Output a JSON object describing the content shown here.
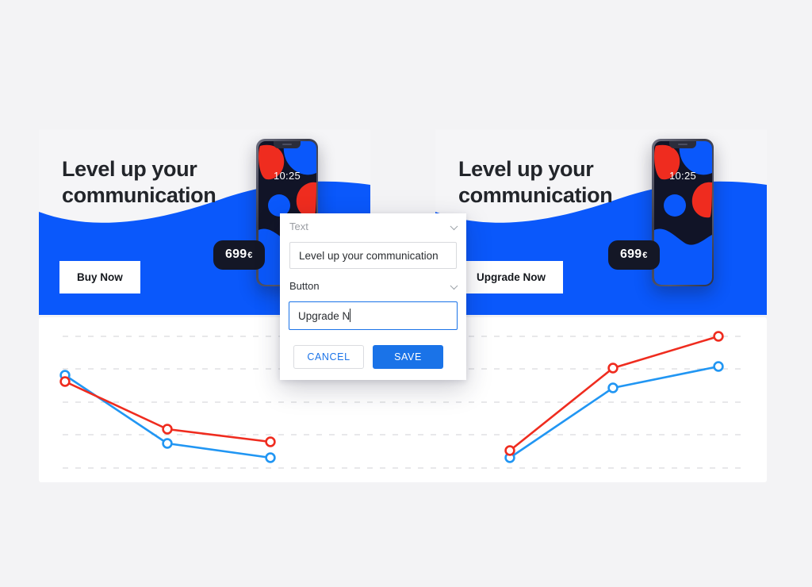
{
  "theme": {
    "page_bg": "#f3f3f5",
    "card_bg": "#f5f5f7",
    "brand_blue": "#0a58fb",
    "accent_blue": "#1a73e8",
    "line_blue": "#2196f3",
    "line_red": "#ef2c1f",
    "dark": "#141726",
    "panel_white": "#ffffff"
  },
  "cards": [
    {
      "id": "card-original",
      "title": "Level up your communication",
      "cta_label": "Buy Now",
      "price": "699",
      "currency": "€",
      "phone_time": "10:25"
    },
    {
      "id": "card-edited",
      "title": "Level up your communication",
      "cta_label": "Upgrade Now",
      "price": "699",
      "currency": "€",
      "phone_time": "10:25"
    }
  ],
  "dialog": {
    "type_select_1": "Text",
    "type_select_1_is_placeholder": true,
    "text_value": "Level up your communication",
    "type_select_2": "Button",
    "button_value": "Upgrade N",
    "cancel_label": "CANCEL",
    "save_label": "SAVE",
    "chevron_icon": "chevron-down-icon"
  },
  "chart_data": {
    "type": "line",
    "title": "",
    "xlabel": "",
    "ylabel": "",
    "grid": true,
    "gridlines_y": [
      424,
      465,
      507,
      548,
      590
    ],
    "legend": "none",
    "panels": [
      {
        "name": "left-chart",
        "x": [
          82,
          211,
          341
        ],
        "series": [
          {
            "name": "blue",
            "color": "#2196f3",
            "values": [
              473,
              559,
              577
            ]
          },
          {
            "name": "red",
            "color": "#ef2c1f",
            "values": [
              481,
              541,
              557
            ]
          }
        ]
      },
      {
        "name": "right-chart",
        "x": [
          643,
          773,
          906
        ],
        "series": [
          {
            "name": "blue",
            "color": "#2196f3",
            "values": [
              577,
              489,
              462
            ]
          },
          {
            "name": "red",
            "color": "#ef2c1f",
            "values": [
              568,
              464,
              424
            ]
          }
        ]
      }
    ]
  }
}
